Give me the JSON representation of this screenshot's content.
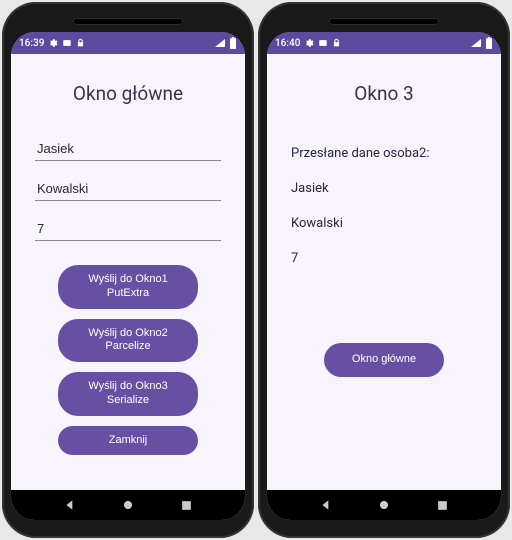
{
  "phone1": {
    "status": {
      "time": "16:39"
    },
    "title": "Okno główne",
    "fields": {
      "first_name": "Jasiek",
      "last_name": "Kowalski",
      "age": "7"
    },
    "buttons": {
      "send1": "Wyślij do Okno1\nPutExtra",
      "send2": "Wyślij do Okno2\nParcelize",
      "send3": "Wyślij do Okno3\nSerialize",
      "close": "Zamknij"
    }
  },
  "phone2": {
    "status": {
      "time": "16:40"
    },
    "title": "Okno 3",
    "received_label": "Przesłane dane osoba2:",
    "received": {
      "first_name": "Jasiek",
      "last_name": "Kowalski",
      "age": "7"
    },
    "buttons": {
      "back": "Okno główne"
    }
  },
  "colors": {
    "accent": "#6750a4",
    "statusbar": "#5b4a9e",
    "background": "#f8f4fb"
  }
}
